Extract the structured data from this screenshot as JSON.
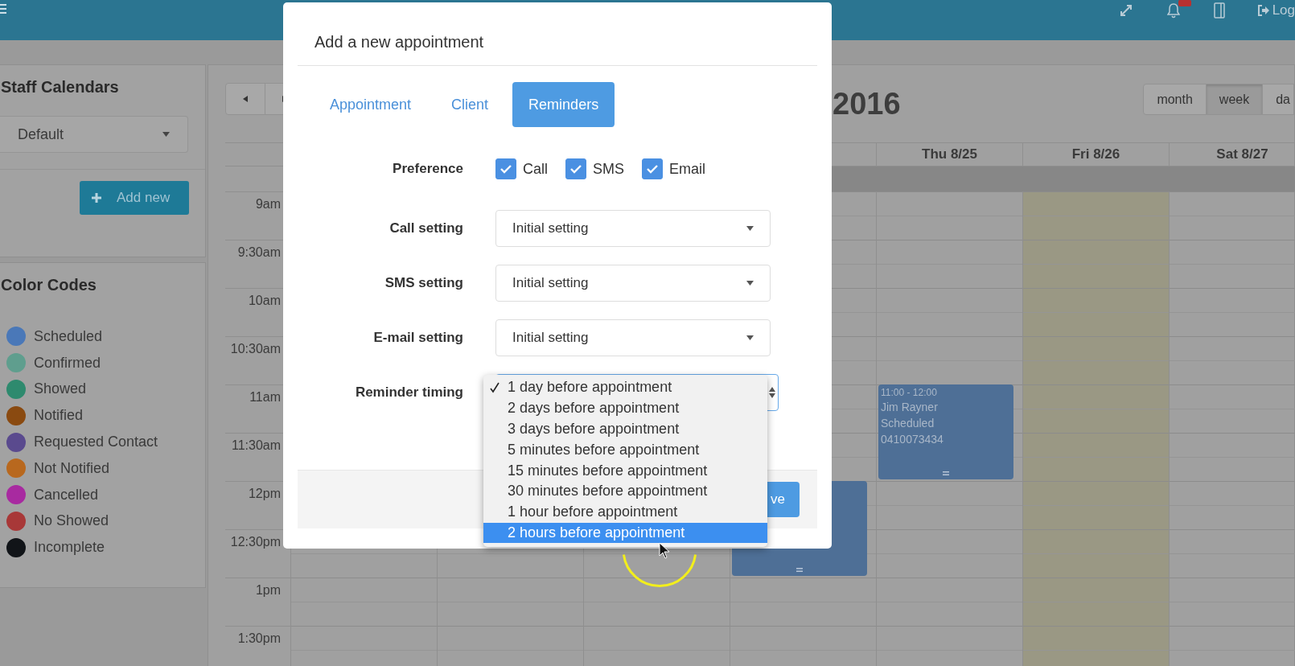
{
  "topbar": {
    "logout_label": "Log"
  },
  "sidebar": {
    "staff_calendars": {
      "title": "Staff Calendars",
      "calendar_select": "Default",
      "add_button": "Add new"
    },
    "color_codes": {
      "title": "Color Codes",
      "items": [
        {
          "label": "Scheduled",
          "color": "#4a78b8"
        },
        {
          "label": "Confirmed",
          "color": "#5f9e8e"
        },
        {
          "label": "Showed",
          "color": "#2e8a6e"
        },
        {
          "label": "Notified",
          "color": "#8a4a10"
        },
        {
          "label": "Requested Contact",
          "color": "#5a4a8e"
        },
        {
          "label": "Not Notified",
          "color": "#b8681e"
        },
        {
          "label": "Cancelled",
          "color": "#a82aa0"
        },
        {
          "label": "No Showed",
          "color": "#a83838"
        },
        {
          "label": "Incomplete",
          "color": "#111418"
        }
      ]
    }
  },
  "calendar": {
    "title": "2016",
    "views": [
      {
        "label": "month",
        "selected": false
      },
      {
        "label": "week",
        "selected": true
      },
      {
        "label": "da",
        "selected": false
      }
    ],
    "days": [
      {
        "label": "Thu 8/25",
        "today": false
      },
      {
        "label": "Fri 8/26",
        "today": true
      },
      {
        "label": "Sat 8/27",
        "today": false
      }
    ],
    "times": [
      "9am",
      "9:30am",
      "10am",
      "10:30am",
      "11am",
      "11:30am",
      "12pm",
      "12:30pm",
      "1pm",
      "1:30pm"
    ],
    "events": [
      {
        "color": "#4e6f96",
        "time": "11:00 - 12:00",
        "lines": [
          "Jim Rayner",
          "Scheduled",
          "0410073434"
        ]
      },
      {
        "color": "#4e6f96"
      }
    ]
  },
  "modal": {
    "title": "Add a new appointment",
    "tabs": [
      {
        "label": "Appointment",
        "selected": false
      },
      {
        "label": "Client",
        "selected": false
      },
      {
        "label": "Reminders",
        "selected": true
      }
    ],
    "preference": {
      "label": "Preference",
      "options": [
        {
          "label": "Call",
          "checked": true
        },
        {
          "label": "SMS",
          "checked": true
        },
        {
          "label": "Email",
          "checked": true
        }
      ]
    },
    "settings": [
      {
        "label": "Call setting",
        "value": "Initial setting"
      },
      {
        "label": "SMS setting",
        "value": "Initial setting"
      },
      {
        "label": "E-mail setting",
        "value": "Initial setting"
      }
    ],
    "reminder_timing": {
      "label": "Reminder timing",
      "options": [
        {
          "label": "1 day before appointment",
          "checked": true,
          "highlighted": false
        },
        {
          "label": "2 days before appointment",
          "checked": false,
          "highlighted": false
        },
        {
          "label": "3 days before appointment",
          "checked": false,
          "highlighted": false
        },
        {
          "label": "5 minutes before appointment",
          "checked": false,
          "highlighted": false
        },
        {
          "label": "15 minutes before appointment",
          "checked": false,
          "highlighted": false
        },
        {
          "label": "30 minutes before appointment",
          "checked": false,
          "highlighted": false
        },
        {
          "label": "1 hour before appointment",
          "checked": false,
          "highlighted": false
        },
        {
          "label": "2 hours before appointment",
          "checked": false,
          "highlighted": true
        }
      ]
    },
    "save_button": "ve"
  }
}
